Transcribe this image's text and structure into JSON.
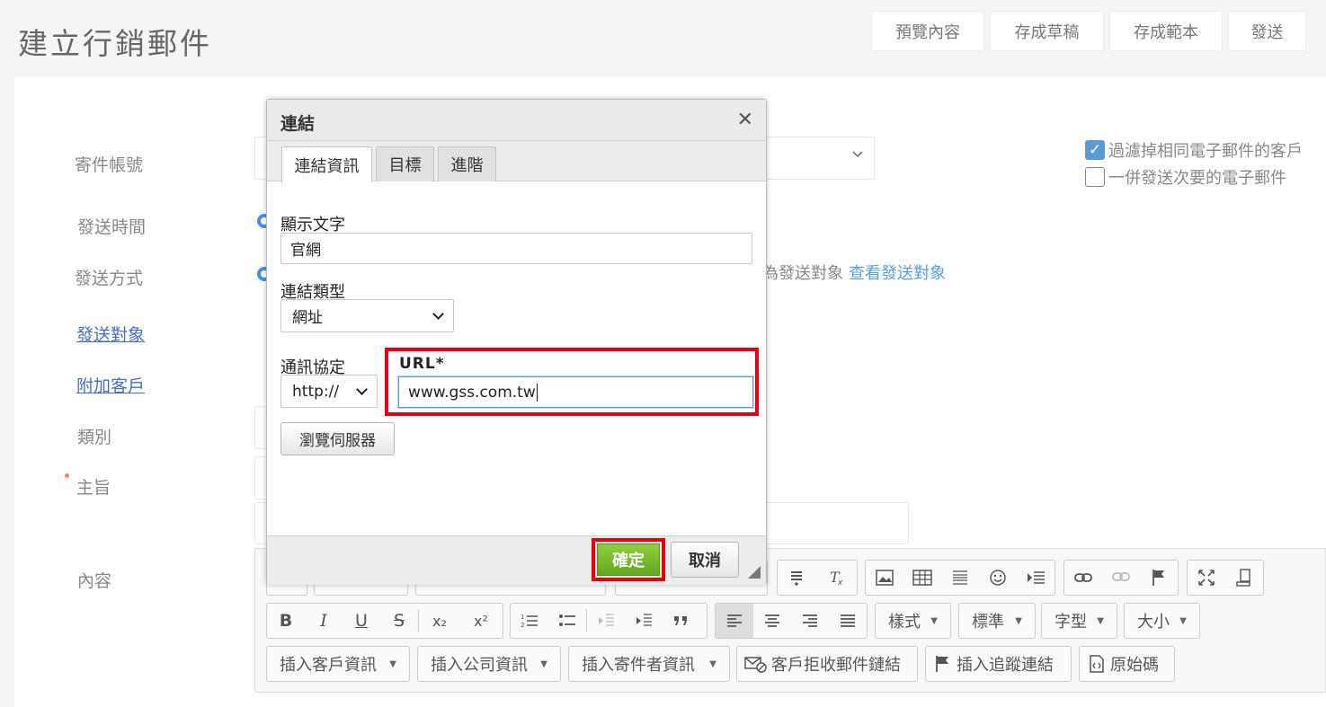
{
  "page": {
    "title": "建立行銷郵件",
    "actions": [
      "預覽內容",
      "存成草稿",
      "存成範本",
      "發送"
    ]
  },
  "form": {
    "labels": {
      "sender_account": "寄件帳號",
      "send_time": "發送時間",
      "send_method": "發送方式",
      "recipients": "發送對象",
      "add_customer": "附加客戶",
      "category": "類別",
      "subject": "主旨",
      "content": "內容"
    },
    "send_method_suffix": "為發送對象",
    "view_recipients": "查看發送對象",
    "options": {
      "filter_duplicate": "過濾掉相同電子郵件的客戶",
      "filter_duplicate_checked": true,
      "send_secondary": "一併發送次要的電子郵件",
      "send_secondary_checked": false
    }
  },
  "editor": {
    "format_buttons": [
      "B",
      "I",
      "U",
      "S",
      "x₂",
      "x²"
    ],
    "combos": [
      "樣式",
      "標準",
      "字型",
      "大小"
    ],
    "insert_buttons": [
      "插入客戶資訊",
      "插入公司資訊",
      "插入寄件者資訊",
      "客戶拒收郵件鏈結",
      "插入追蹤連結",
      "原始碼"
    ]
  },
  "dialog": {
    "title": "連結",
    "close": "✕",
    "tabs": [
      "連結資訊",
      "目標",
      "進階"
    ],
    "display_text_label": "顯示文字",
    "display_text_value": "官網",
    "link_type_label": "連結類型",
    "link_type_value": "網址",
    "protocol_label": "通訊協定",
    "protocol_value": "http://",
    "url_label": "URL*",
    "url_value": "www.gss.com.tw",
    "browse_server": "瀏覽伺服器",
    "ok": "確定",
    "cancel": "取消"
  },
  "colors": {
    "highlight": "#e60012",
    "ok_button": "#6db226",
    "link": "#4a6fb8"
  }
}
